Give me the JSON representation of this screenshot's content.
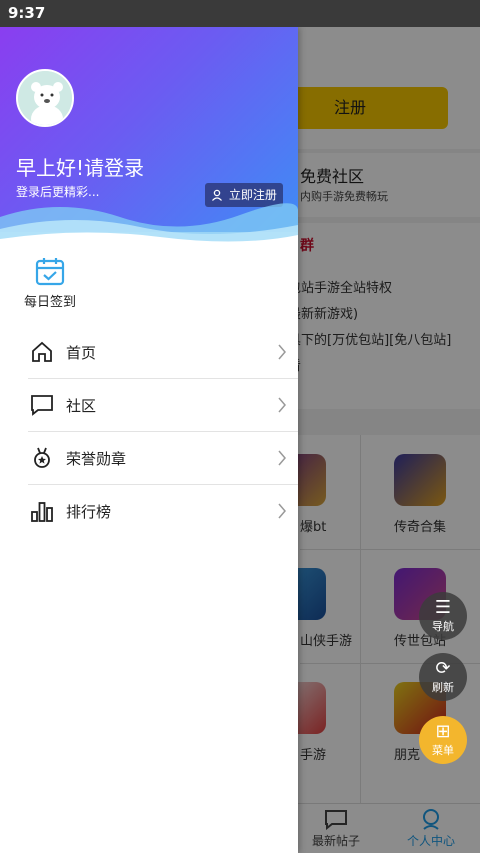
{
  "status_bar": {
    "time": "9:37"
  },
  "drawer": {
    "greeting": "早上好!请登录",
    "login_hint": "登录后更精彩...",
    "register_label": "立即注册",
    "checkin_label": "每日签到",
    "menu": [
      {
        "label": "首页",
        "icon": "home-icon"
      },
      {
        "label": "社区",
        "icon": "chat-icon"
      },
      {
        "label": "荣誉勋章",
        "icon": "medal-icon"
      },
      {
        "label": "排行榜",
        "icon": "bar-chart-icon"
      }
    ]
  },
  "background": {
    "register_button": "注册",
    "community_title": "免费社区",
    "community_subtitle": "内购手游免费畅玩",
    "group_title": "群",
    "group_lines": [
      "包站手游全站特权",
      "最新新游戏)",
      "具下的[万优包站][免八包站]",
      "看"
    ],
    "games": [
      {
        "name": "爆bt"
      },
      {
        "name": "传奇合集"
      },
      {
        "name": "山侠手游"
      },
      {
        "name": "传世包站"
      },
      {
        "name": "手游"
      },
      {
        "name": "朋克"
      }
    ],
    "bottom_nav": [
      {
        "label": "最新帖子"
      },
      {
        "label": "个人中心"
      }
    ]
  },
  "fabs": {
    "nav_label": "导航",
    "refresh_label": "刷新",
    "menu_label": "菜单"
  },
  "colors": {
    "accent_yellow": "#f6c700",
    "header_gradient_start": "#8a3ef0",
    "header_gradient_end": "#3f8cf5",
    "active_blue": "#1e9be6"
  }
}
